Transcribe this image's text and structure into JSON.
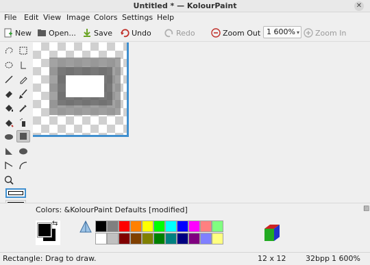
{
  "window": {
    "title": "Untitled * — KolourPaint"
  },
  "menu": [
    {
      "label": "File",
      "mnemonic": "F"
    },
    {
      "label": "Edit",
      "mnemonic": "E"
    },
    {
      "label": "View",
      "mnemonic": "V"
    },
    {
      "label": "Image",
      "mnemonic": "I"
    },
    {
      "label": "Colors",
      "mnemonic": "C"
    },
    {
      "label": "Settings",
      "mnemonic": "S"
    },
    {
      "label": "Help",
      "mnemonic": "H"
    }
  ],
  "toolbar": {
    "new": "New",
    "open": "Open...",
    "save": "Save",
    "undo": "Undo",
    "redo": "Redo",
    "zoom_out": "Zoom Out",
    "zoom_level": "1 600%",
    "zoom_in": "Zoom In"
  },
  "palette": {
    "title": "Colors: &KolourPaint Defaults [modified]",
    "foreground": "#000000",
    "background": "#000000",
    "row1": [
      "#000000",
      "#808080",
      "#ff0000",
      "#ff8000",
      "#ffff00",
      "#00ff00",
      "#00ffff",
      "#0000ff",
      "#ff00ff",
      "#ff8080",
      "#80ff80"
    ],
    "row2": [
      "#ffffff",
      "#c0c0c0",
      "#800000",
      "#804000",
      "#808000",
      "#008000",
      "#008080",
      "#000080",
      "#800080",
      "#8080ff",
      "#ffff80"
    ]
  },
  "status": {
    "hint": "Rectangle: Drag to draw.",
    "dimensions": "12 x 12",
    "depth": "32bpp",
    "zoom": "1 600%"
  },
  "accent_color": "#3f8fcf"
}
